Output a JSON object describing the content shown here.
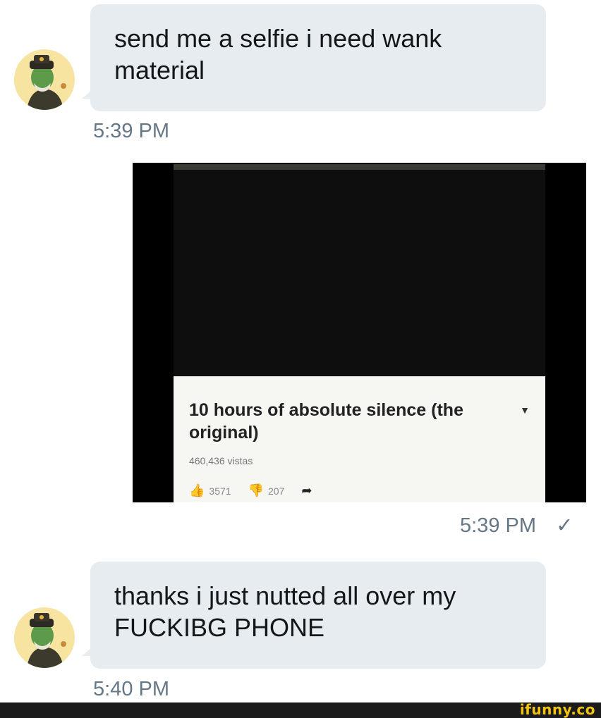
{
  "messages": [
    {
      "text_line1": "send me a selfie i need wank",
      "text_line2": "material",
      "time": "5:39 PM"
    },
    {
      "time": "5:39 PM",
      "read_mark": "✓"
    },
    {
      "text_line1": "thanks i just nutted all over my",
      "text_line2": "FUCKIBG PHONE",
      "time": "5:40 PM"
    }
  ],
  "shared_image": {
    "title_line1": "10 hours of absolute silence (the",
    "title_line2": "original)",
    "views": "460,436 vistas",
    "likes": "3571",
    "dislikes": "207"
  },
  "watermark": {
    "text": "ifunny.co",
    "color": "#f2c311"
  },
  "colors": {
    "bubble": "#e6ecf0",
    "timestamp": "#657786",
    "text": "#14171a"
  },
  "icons": [
    "avatar-icon",
    "caret-down-icon",
    "thumbs-up-icon",
    "thumbs-down-icon",
    "share-icon",
    "checkmark-icon"
  ]
}
